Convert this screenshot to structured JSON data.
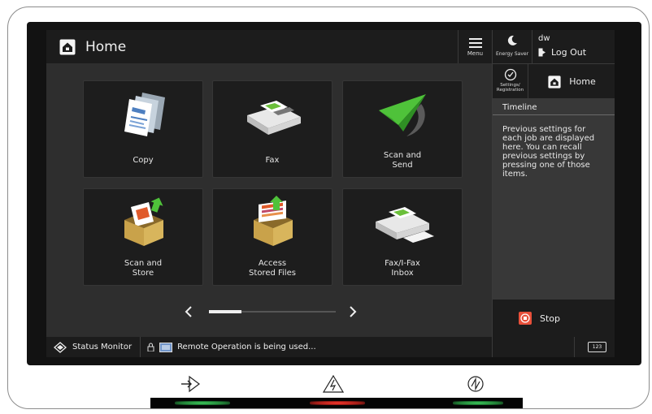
{
  "header": {
    "title": "Home",
    "menu_label": "Menu"
  },
  "tiles": [
    {
      "label": "Copy",
      "icon": "copy-icon"
    },
    {
      "label": "Fax",
      "icon": "fax-icon"
    },
    {
      "label": "Scan and\nSend",
      "icon": "scan-send-icon"
    },
    {
      "label": "Scan and\nStore",
      "icon": "scan-store-icon"
    },
    {
      "label": "Access\nStored Files",
      "icon": "stored-files-icon"
    },
    {
      "label": "Fax/I-Fax\nInbox",
      "icon": "fax-inbox-icon"
    }
  ],
  "pager": {
    "prev": "‹",
    "next": "›",
    "page": 1,
    "pages": 3
  },
  "statusbar": {
    "status_monitor": "Status Monitor",
    "remote": "Remote Operation is being used..."
  },
  "right_panel": {
    "energy_saver": "Energy Saver",
    "user": "dw",
    "logout": "Log Out",
    "settings": "Settings/\nRegistration",
    "home": "Home",
    "timeline_title": "Timeline",
    "timeline_body": "Previous settings for each job are displayed here. You can recall previous settings by pressing one of those items.",
    "stop": "Stop",
    "keypad": "123"
  },
  "hardware": {
    "keys": [
      "data-arrow-icon",
      "error-warning-icon",
      "power-icon"
    ],
    "led_colors": [
      "#2fa84a",
      "#d0302a",
      "#2fa84a"
    ]
  }
}
